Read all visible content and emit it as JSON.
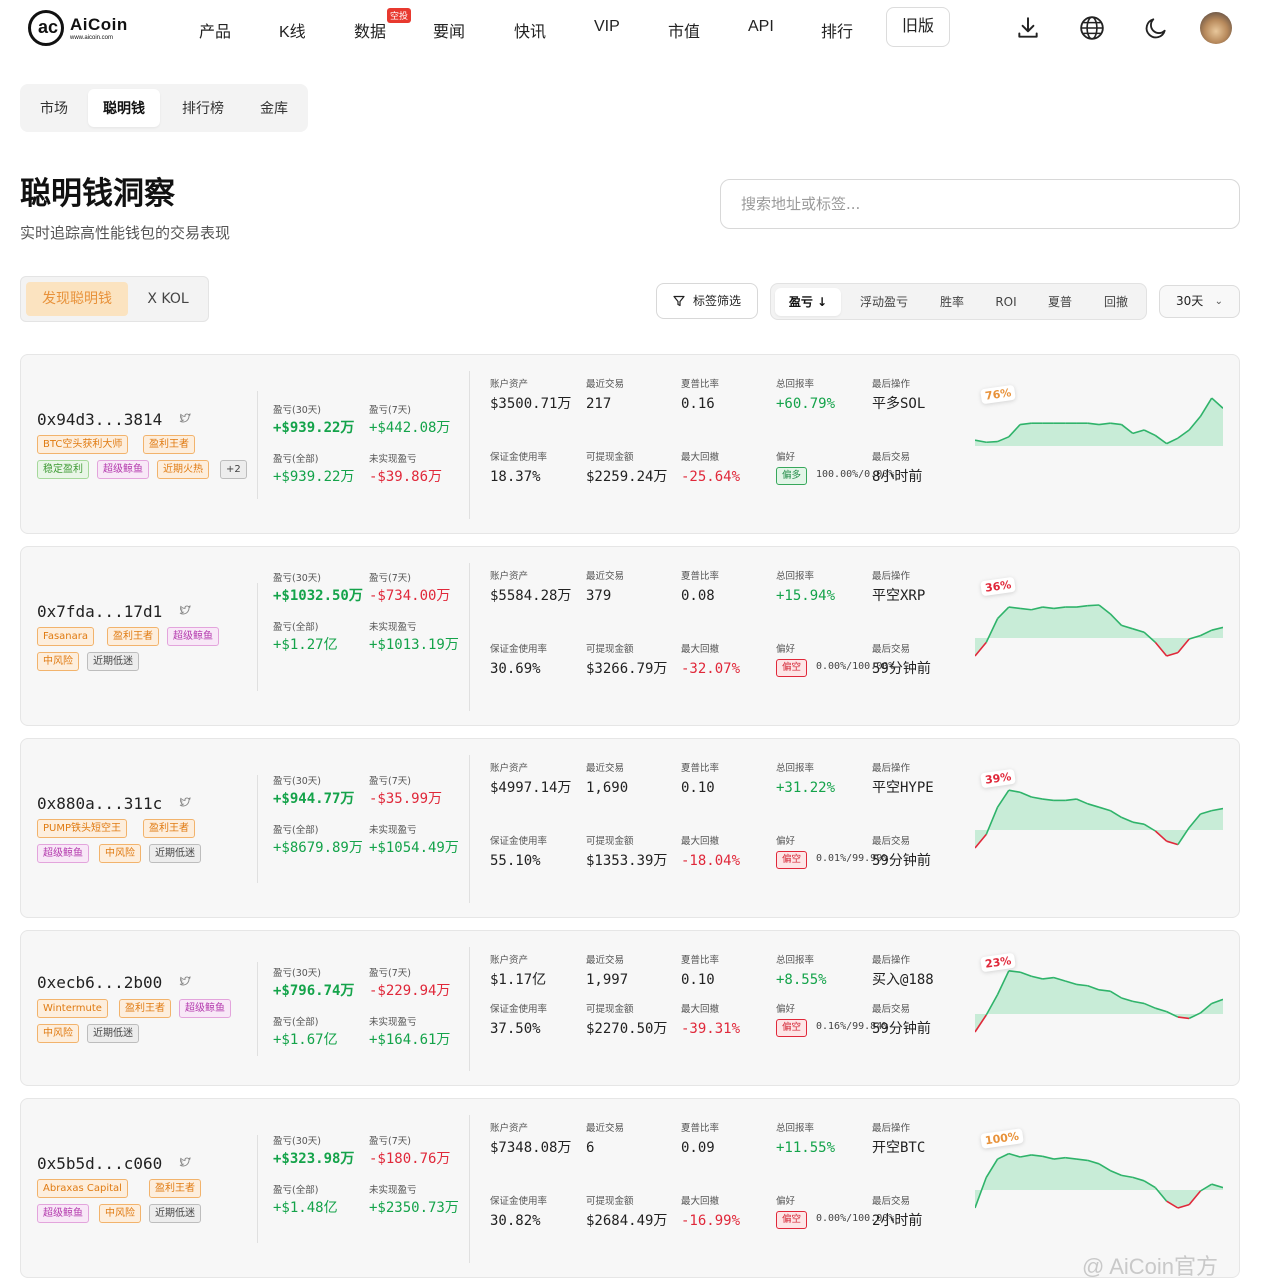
{
  "header": {
    "logo_mark": "ac",
    "logo_text": "AiCoin",
    "logo_sub": "www.aicoin.com",
    "nav": [
      "产品",
      "K线",
      "数据",
      "要闻",
      "快讯",
      "VIP",
      "市值",
      "API",
      "排行"
    ],
    "nav_badge": "空投",
    "old_version": "旧版",
    "icons": [
      "download-icon",
      "globe-icon",
      "moon-icon",
      "avatar"
    ]
  },
  "subtabs": [
    "市场",
    "聪明钱",
    "排行榜",
    "金库"
  ],
  "page": {
    "title": "聪明钱洞察",
    "subtitle": "实时追踪高性能钱包的交易表现",
    "search_placeholder": "搜索地址或标签..."
  },
  "modes": [
    "发现聪明钱",
    "X KOL"
  ],
  "toolbar": {
    "filter_label": "标签筛选",
    "sorts": [
      "盈亏 ↓",
      "浮动盈亏",
      "胜率",
      "ROI",
      "夏普",
      "回撤"
    ],
    "period": "30天"
  },
  "labels": {
    "pnl30": "盈亏(30天)",
    "pnl7": "盈亏(7天)",
    "pnl_all": "盈亏(全部)",
    "unrealized": "未实现盈亏",
    "assets": "账户资产",
    "recent_trades": "最近交易",
    "sharpe": "夏普比率",
    "total_return": "总回报率",
    "last_action": "最后操作",
    "margin_usage": "保证金使用率",
    "withdrawable": "可提现金额",
    "max_drawdown": "最大回撤",
    "preference": "偏好",
    "last_trade": "最后交易"
  },
  "wallets": [
    {
      "address": "0x94d3...3814",
      "tags": [
        "BTC空头获利大师",
        "盈利王者",
        "稳定盈利",
        "超级鲸鱼",
        "近期火热",
        "+2"
      ],
      "pnl30": "+$939.22万",
      "pnl7": "+$442.08万",
      "pnl_all": "+$939.22万",
      "unrealized": "-$39.86万",
      "assets": "$3500.71万",
      "recent_trades": "217",
      "sharpe": "0.16",
      "total_return": "+60.79%",
      "last_action": "平多SOL",
      "margin_usage": "18.37%",
      "withdrawable": "$2259.24万",
      "max_drawdown": "-25.64%",
      "preference_tag": "偏多",
      "preference_text": "100.00%/0.00%",
      "last_trade": "8小时前",
      "winrate_badge": "76%",
      "spark": [
        0.35,
        0.32,
        0.33,
        0.4,
        0.58,
        0.6,
        0.6,
        0.6,
        0.6,
        0.6,
        0.6,
        0.58,
        0.6,
        0.58,
        0.45,
        0.5,
        0.42,
        0.3,
        0.38,
        0.5,
        0.7,
        0.97,
        0.82
      ]
    },
    {
      "address": "0x7fda...17d1",
      "tags": [
        "Fasanara",
        "盈利王者",
        "超级鲸鱼",
        "中风险",
        "近期低迷"
      ],
      "pnl30": "+$1032.50万",
      "pnl7": "-$734.00万",
      "pnl_all": "+$1.27亿",
      "unrealized": "+$1013.19万",
      "assets": "$5584.28万",
      "recent_trades": "379",
      "sharpe": "0.08",
      "total_return": "+15.94%",
      "last_action": "平空XRP",
      "margin_usage": "30.69%",
      "withdrawable": "$3266.79万",
      "max_drawdown": "-32.07%",
      "preference_tag": "偏空",
      "preference_text": "0.00%/100.00%",
      "last_trade": "59分钟前",
      "winrate_badge": "36%",
      "spark": [
        0.0,
        0.2,
        0.55,
        0.72,
        0.7,
        0.68,
        0.72,
        0.7,
        0.72,
        0.72,
        0.74,
        0.75,
        0.62,
        0.45,
        0.4,
        0.35,
        0.2,
        0.0,
        0.05,
        0.25,
        0.3,
        0.38,
        0.42
      ]
    },
    {
      "address": "0x880a...311c",
      "tags": [
        "PUMP铁头短空王",
        "盈利王者",
        "超级鲸鱼",
        "中风险",
        "近期低迷"
      ],
      "pnl30": "+$944.77万",
      "pnl7": "-$35.99万",
      "pnl_all": "+$8679.89万",
      "unrealized": "+$1054.49万",
      "assets": "$4997.14万",
      "recent_trades": "1,690",
      "sharpe": "0.10",
      "total_return": "+31.22%",
      "last_action": "平空HYPE",
      "margin_usage": "55.10%",
      "withdrawable": "$1353.39万",
      "max_drawdown": "-18.04%",
      "preference_tag": "偏空",
      "preference_text": "0.01%/99.99%",
      "last_trade": "59分钟前",
      "winrate_badge": "39%",
      "spark": [
        0.0,
        0.2,
        0.6,
        0.85,
        0.82,
        0.75,
        0.72,
        0.7,
        0.7,
        0.72,
        0.65,
        0.6,
        0.55,
        0.45,
        0.38,
        0.35,
        0.25,
        0.1,
        0.05,
        0.3,
        0.5,
        0.55,
        0.58
      ]
    },
    {
      "address": "0xecb6...2b00",
      "tags": [
        "Wintermute",
        "盈利王者",
        "超级鲸鱼",
        "中风险",
        "近期低迷"
      ],
      "pnl30": "+$796.74万",
      "pnl7": "-$229.94万",
      "pnl_all": "+$1.67亿",
      "unrealized": "+$164.61万",
      "assets": "$1.17亿",
      "recent_trades": "1,997",
      "sharpe": "0.10",
      "total_return": "+8.55%",
      "last_action": "买入@188",
      "margin_usage": "37.50%",
      "withdrawable": "$2270.50万",
      "max_drawdown": "-39.31%",
      "preference_tag": "偏空",
      "preference_text": "0.16%/99.84%",
      "last_trade": "59分钟前",
      "winrate_badge": "23%",
      "spark": [
        0.0,
        0.25,
        0.55,
        0.9,
        0.88,
        0.82,
        0.78,
        0.8,
        0.75,
        0.7,
        0.68,
        0.62,
        0.6,
        0.5,
        0.45,
        0.42,
        0.35,
        0.3,
        0.22,
        0.2,
        0.28,
        0.42,
        0.48
      ]
    },
    {
      "address": "0x5b5d...c060",
      "tags": [
        "Abraxas Capital",
        "盈利王者",
        "超级鲸鱼",
        "中风险",
        "近期低迷"
      ],
      "pnl30": "+$323.98万",
      "pnl7": "-$180.76万",
      "pnl_all": "+$1.48亿",
      "unrealized": "+$2350.73万",
      "assets": "$7348.08万",
      "recent_trades": "6",
      "sharpe": "0.09",
      "total_return": "+11.55%",
      "last_action": "开空BTC",
      "margin_usage": "30.82%",
      "withdrawable": "$2684.49万",
      "max_drawdown": "-16.99%",
      "preference_tag": "偏空",
      "preference_text": "0.00%/100.00%",
      "last_trade": "2小时前",
      "winrate_badge": "100%",
      "spark": [
        0.0,
        0.45,
        0.72,
        0.8,
        0.75,
        0.78,
        0.76,
        0.72,
        0.74,
        0.72,
        0.7,
        0.65,
        0.55,
        0.48,
        0.45,
        0.4,
        0.3,
        0.1,
        0.0,
        0.05,
        0.25,
        0.35,
        0.3
      ]
    }
  ],
  "watermark": "@ AiCoin官方",
  "colors": {
    "positive": "#14a34a",
    "negative": "#e0283a",
    "accent": "#e8923a",
    "area": "#c8ecd7"
  }
}
